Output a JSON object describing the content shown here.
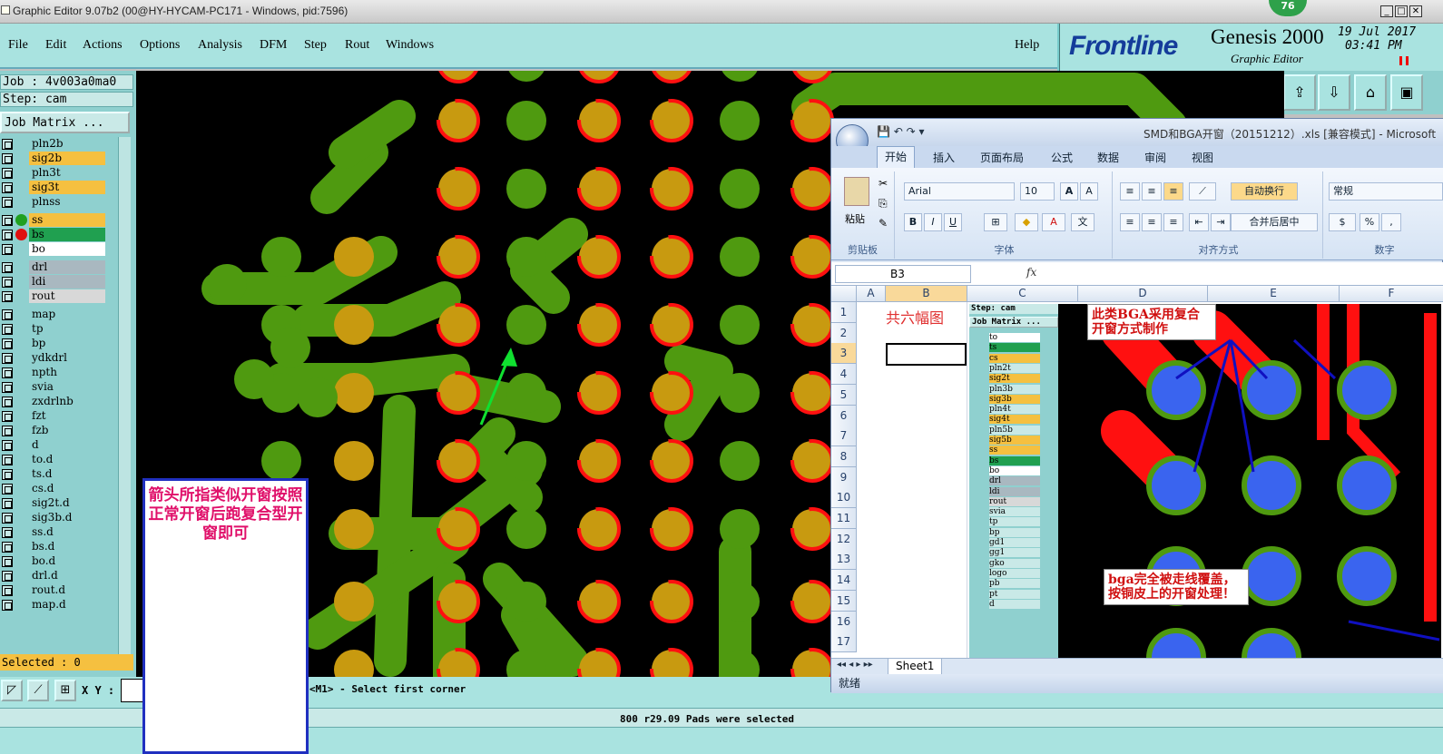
{
  "window": {
    "title": "Graphic Editor 9.07b2 (00@HY-HYCAM-PC171 - Windows, pid:7596)"
  },
  "menu": [
    "File",
    "Edit",
    "Actions",
    "Options",
    "Analysis",
    "DFM",
    "Step",
    "Rout",
    "Windows"
  ],
  "help": "Help",
  "logo": {
    "brand": "Frontline",
    "product": "Genesis 2000",
    "sub": "Graphic Editor",
    "date": "19 Jul 2017",
    "time": "03:41 PM"
  },
  "badge": "76",
  "job": {
    "job_line": "Job : 4v003a0ma0",
    "step_line": "Step: cam",
    "matrix_btn": "Job Matrix ..."
  },
  "layers": [
    {
      "name": "pln2b",
      "color": "#8fd0cf"
    },
    {
      "name": "sig2b",
      "color": "#f5c040"
    },
    {
      "name": "pln3t",
      "color": "#8fd0cf"
    },
    {
      "name": "sig3t",
      "color": "#f5c040"
    },
    {
      "name": "plnss",
      "color": "#8fd0cf"
    },
    {
      "name": "ss",
      "color": "#f5c040",
      "dot": "#20a020"
    },
    {
      "name": "bs",
      "color": "#20a050",
      "dot": "#e01010"
    },
    {
      "name": "bo",
      "color": "#ffffff"
    },
    {
      "name": "drl",
      "color": "#a9b8c0"
    },
    {
      "name": "ldi",
      "color": "#a9b8c0"
    },
    {
      "name": "rout",
      "color": "#d8d8d8"
    },
    {
      "name": "map",
      "color": "#8fd0cf"
    },
    {
      "name": "tp",
      "color": "#8fd0cf"
    },
    {
      "name": "bp",
      "color": "#8fd0cf"
    },
    {
      "name": "ydkdrl",
      "color": "#8fd0cf"
    },
    {
      "name": "npth",
      "color": "#8fd0cf"
    },
    {
      "name": "svia",
      "color": "#8fd0cf"
    },
    {
      "name": "zxdrlnb",
      "color": "#8fd0cf"
    },
    {
      "name": "fzt",
      "color": "#8fd0cf"
    },
    {
      "name": "fzb",
      "color": "#8fd0cf"
    },
    {
      "name": "d",
      "color": "#8fd0cf"
    },
    {
      "name": "to.d",
      "color": "#8fd0cf"
    },
    {
      "name": "ts.d",
      "color": "#8fd0cf"
    },
    {
      "name": "cs.d",
      "color": "#8fd0cf"
    },
    {
      "name": "sig2t.d",
      "color": "#8fd0cf"
    },
    {
      "name": "sig3b.d",
      "color": "#8fd0cf"
    },
    {
      "name": "ss.d",
      "color": "#8fd0cf"
    },
    {
      "name": "bs.d",
      "color": "#8fd0cf"
    },
    {
      "name": "bo.d",
      "color": "#8fd0cf"
    },
    {
      "name": "drl.d",
      "color": "#8fd0cf"
    },
    {
      "name": "rout.d",
      "color": "#8fd0cf"
    },
    {
      "name": "map.d",
      "color": "#8fd0cf"
    }
  ],
  "selected_text": "Selected : 0",
  "bottom": {
    "xy_label": "X Y :",
    "prompt": "<M1> - Select first corner",
    "status": "800 r29.09 Pads were selected"
  },
  "note_box": "箭头所指类似开窗按照正常开窗后跑复合型开窗即可",
  "excel": {
    "title": "SMD和BGA开窗（20151212）.xls  [兼容模式] - Microsoft",
    "tabs": [
      "开始",
      "插入",
      "页面布局",
      "公式",
      "数据",
      "审阅",
      "视图"
    ],
    "paste": "粘贴",
    "clipboard": "剪贴板",
    "font_name": "Arial",
    "font_size": "10",
    "font_group": "字体",
    "wrap": "自动换行",
    "merge": "合并后居中",
    "align_group": "对齐方式",
    "number_format": "常规",
    "number_group": "数字",
    "name_box": "B3",
    "fx": "fx",
    "columns": [
      "A",
      "B",
      "C",
      "D",
      "E",
      "F"
    ],
    "rows": [
      "1",
      "2",
      "3",
      "4",
      "5",
      "6",
      "7",
      "8",
      "9",
      "10",
      "11",
      "12",
      "13",
      "14",
      "15",
      "16",
      "17"
    ],
    "b1": "共六幅图",
    "sheet": "Sheet1",
    "status": "就绪",
    "emb_step": "Step: cam",
    "emb_matrix": "Job Matrix ...",
    "emb_layers": [
      "to",
      "ts",
      "cs",
      "pln2t",
      "sig2t",
      "pln3b",
      "sig3b",
      "pln4t",
      "sig4t",
      "pln5b",
      "sig5b",
      "ss",
      "bs",
      "bo",
      "drl",
      "ldi",
      "rout",
      "svia",
      "tp",
      "bp",
      "gd1",
      "gg1",
      "gko",
      "logo",
      "pb",
      "pt",
      "d"
    ],
    "note1": "此类BGA采用复合开窗方式制作",
    "note2": "bga完全被走线覆盖，按铜皮上的开窗处理！"
  },
  "icons": {
    "toolbar": [
      "import-icon",
      "export-icon",
      "home-icon",
      "window-icon"
    ],
    "bottom": [
      "select-icon",
      "measure-icon",
      "grid-icon"
    ]
  }
}
